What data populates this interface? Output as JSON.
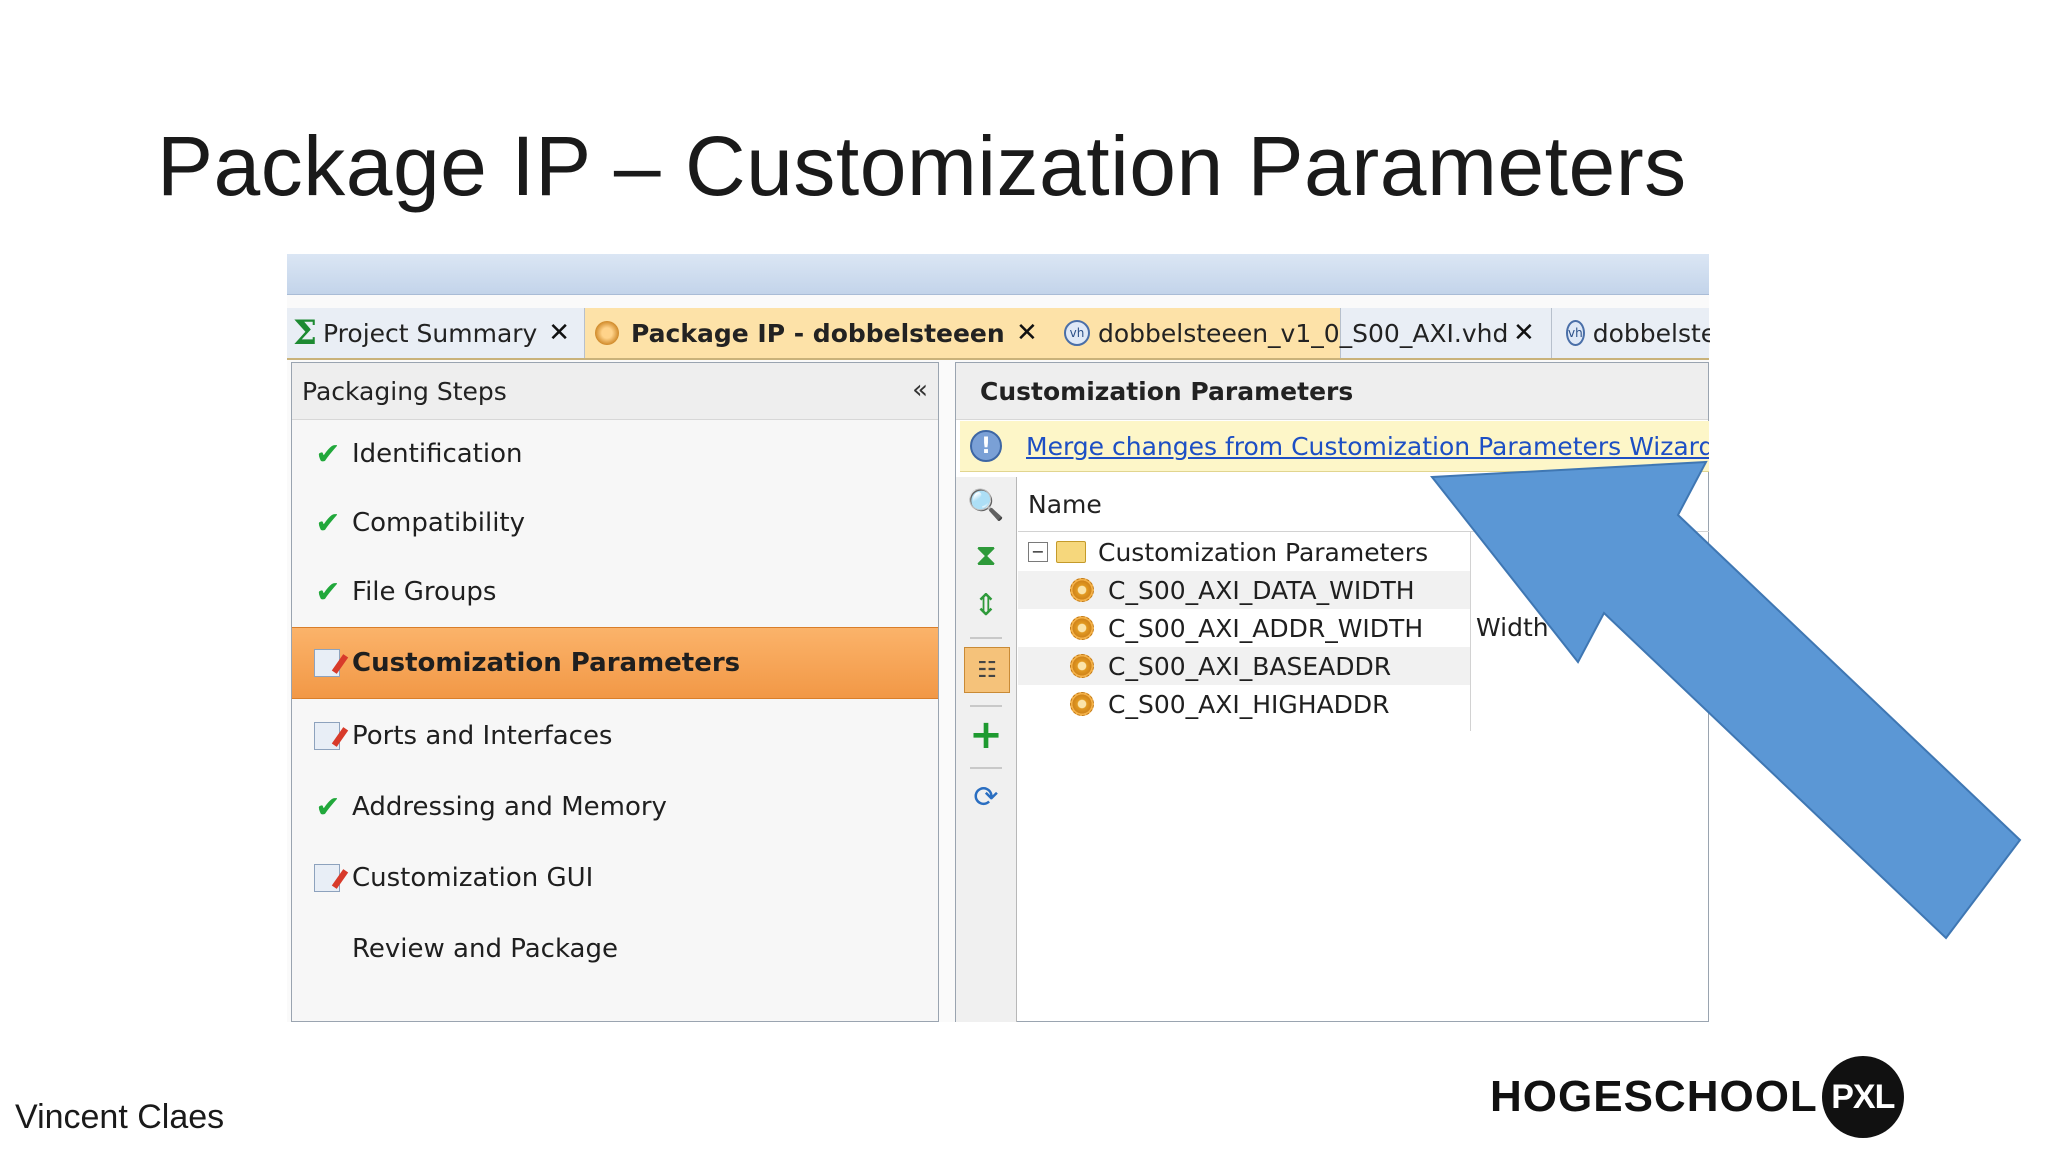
{
  "slide": {
    "title": "Package IP – Customization Parameters",
    "author": "Vincent Claes",
    "logo_text": "HOGESCHOOL",
    "logo_badge": "PXL"
  },
  "tabs": [
    {
      "label": "Project Summary",
      "icon": "sigma-icon",
      "active": false
    },
    {
      "label": "Package IP - dobbelsteeen",
      "icon": "package-ip-icon",
      "active": true
    },
    {
      "label": "dobbelsteeen_v1_0_S00_AXI.vhd",
      "icon": "vhdl-file-icon",
      "active": false
    },
    {
      "label": "dobbelste",
      "icon": "vhdl-file-icon",
      "active": false
    }
  ],
  "tab_close_glyph": "✕",
  "vhd_badge_text": "vh",
  "packaging_steps": {
    "header": "Packaging Steps",
    "collapse_glyph": "«",
    "items": [
      {
        "label": "Identification",
        "status": "complete"
      },
      {
        "label": "Compatibility",
        "status": "complete"
      },
      {
        "label": "File Groups",
        "status": "complete"
      },
      {
        "label": "Customization Parameters",
        "status": "edited",
        "selected": true
      },
      {
        "label": "Ports and Interfaces",
        "status": "edited"
      },
      {
        "label": "Addressing and Memory",
        "status": "complete"
      },
      {
        "label": "Customization GUI",
        "status": "edited"
      },
      {
        "label": "Review and Package",
        "status": "none"
      }
    ]
  },
  "customization": {
    "header": "Customization Parameters",
    "merge_link": "Merge changes from Customization Parameters Wizard",
    "column_name": "Name",
    "root_label": "Customization Parameters",
    "params": [
      {
        "name": "C_S00_AXI_DATA_WIDTH"
      },
      {
        "name": "C_S00_AXI_ADDR_WIDTH",
        "description_fragment": "Width o"
      },
      {
        "name": "C_S00_AXI_BASEADDR"
      },
      {
        "name": "C_S00_AXI_HIGHADDR"
      }
    ]
  },
  "toolbar_icons": [
    "search-icon",
    "collapse-all-icon",
    "expand-all-icon",
    "hierarchy-icon",
    "add-icon",
    "refresh-icon"
  ],
  "colors": {
    "arrow_fill": "#5b97d5",
    "arrow_stroke": "#3f77b3",
    "selected_step": "#f29846",
    "check_green": "#21a83b",
    "link_blue": "#1d4fc4"
  }
}
